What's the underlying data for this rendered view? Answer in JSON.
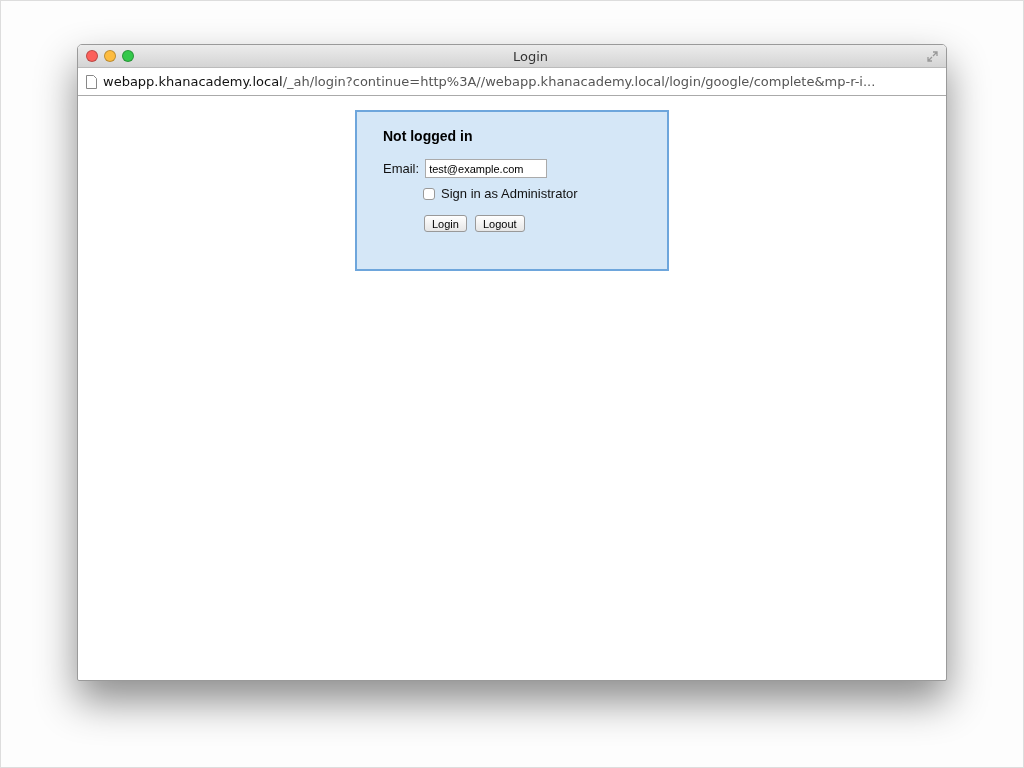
{
  "window": {
    "title": "Login"
  },
  "address_bar": {
    "host": "webapp.khanacademy.local",
    "path": "/_ah/login?continue=http%3A//webapp.khanacademy.local/login/google/complete&mp-r-i..."
  },
  "login_panel": {
    "heading": "Not logged in",
    "email_label": "Email:",
    "email_value": "test@example.com",
    "admin_checkbox": {
      "label": "Sign in as Administrator",
      "checked": false
    },
    "buttons": [
      "Login",
      "Logout"
    ]
  }
}
